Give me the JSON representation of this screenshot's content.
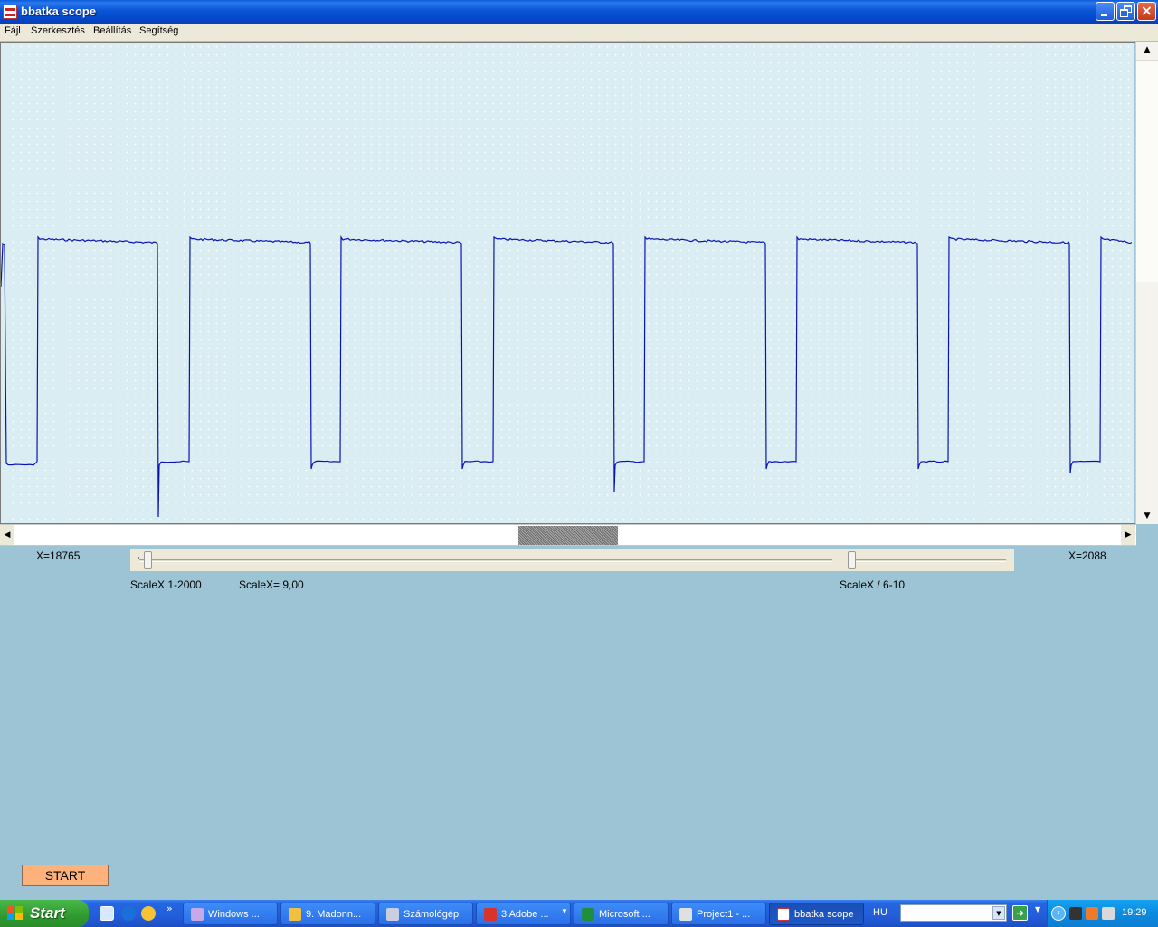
{
  "window": {
    "title": "bbatka scope",
    "controls": {
      "minimize": "minimize",
      "maximize": "restore",
      "close": "×"
    }
  },
  "menu": [
    "Fájl",
    "Szerkesztés",
    "Beállítás",
    "Segítség"
  ],
  "controls": {
    "x_left": "X=18765",
    "x_right": "X=2088",
    "scalex_range": "ScaleX 1-2000",
    "scalex_value": "ScaleX= 9,00",
    "scalex_div": "ScaleX / 6-10",
    "start_button": "START"
  },
  "waveform": {
    "color": "#0a14b4",
    "background": "#d9edf3",
    "high_level": "high",
    "low_level": "low"
  },
  "taskbar": {
    "start": "Start",
    "tasks": [
      {
        "label": "Windows ...",
        "icon": "floppy-icon"
      },
      {
        "label": "9. Madonn...",
        "icon": "pencil-icon"
      },
      {
        "label": "Számológép",
        "icon": "calculator-icon"
      },
      {
        "label": "3 Adobe ...",
        "icon": "adobe-icon"
      },
      {
        "label": "Microsoft ...",
        "icon": "excel-icon"
      },
      {
        "label": "Project1 - ...",
        "icon": "project-icon"
      },
      {
        "label": "bbatka scope",
        "icon": "scope-icon"
      }
    ],
    "language": "HU",
    "clock": "19:29"
  }
}
